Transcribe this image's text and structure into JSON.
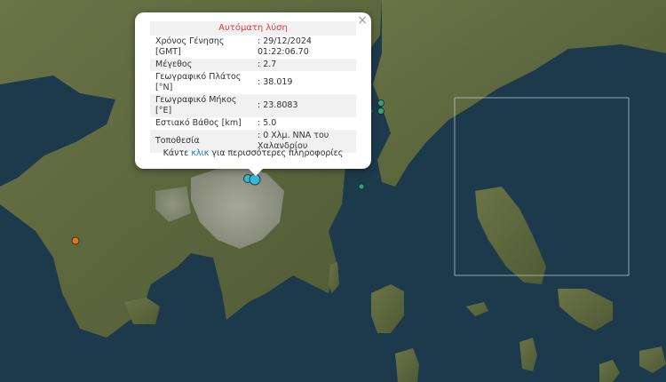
{
  "popup": {
    "close_label": "×",
    "title": "Αυτόματη λύση",
    "rows": [
      {
        "label": "Χρόνος Γένησης [GMT]",
        "value": ": 29/12/2024 01:22:06.70"
      },
      {
        "label": "Μέγεθος",
        "value": ": 2.7"
      },
      {
        "label": "Γεωγραφικό Πλάτος [°N]",
        "value": ": 38.019"
      },
      {
        "label": "Γεωγραφικό Μήκος [°E]",
        "value": ": 23.8083"
      },
      {
        "label": "Εστιακό Βάθος [km]",
        "value": ": 5.0"
      },
      {
        "label": "Τοποθεσία",
        "value": ": 0 Χλμ. ΝΝΑ του Χαλανδρίου"
      }
    ],
    "more_before": "Κάντε",
    "more_link": "κλικ",
    "more_after": "για περισσότερες πληροφορίες"
  },
  "colors": {
    "sea": "#1d3a4c",
    "land": "#5d6a3e",
    "urban": "#9e9f96",
    "selected_marker": "#3bb6d8",
    "green_marker": "#2ea66e",
    "orange_marker": "#e0771f"
  },
  "markers": [
    {
      "name": "selected-earthquake-marker",
      "color": "selected_marker",
      "label": "selected"
    },
    {
      "name": "earthquake-marker-secondary",
      "color": "selected_marker",
      "label": "nearby"
    },
    {
      "name": "earthquake-marker-green-1",
      "color": "green_marker",
      "label": "north-east"
    },
    {
      "name": "earthquake-marker-green-2",
      "color": "green_marker",
      "label": "north-east"
    },
    {
      "name": "earthquake-marker-green-3",
      "color": "green_marker",
      "label": "east"
    },
    {
      "name": "earthquake-marker-orange",
      "color": "orange_marker",
      "label": "west"
    }
  ]
}
